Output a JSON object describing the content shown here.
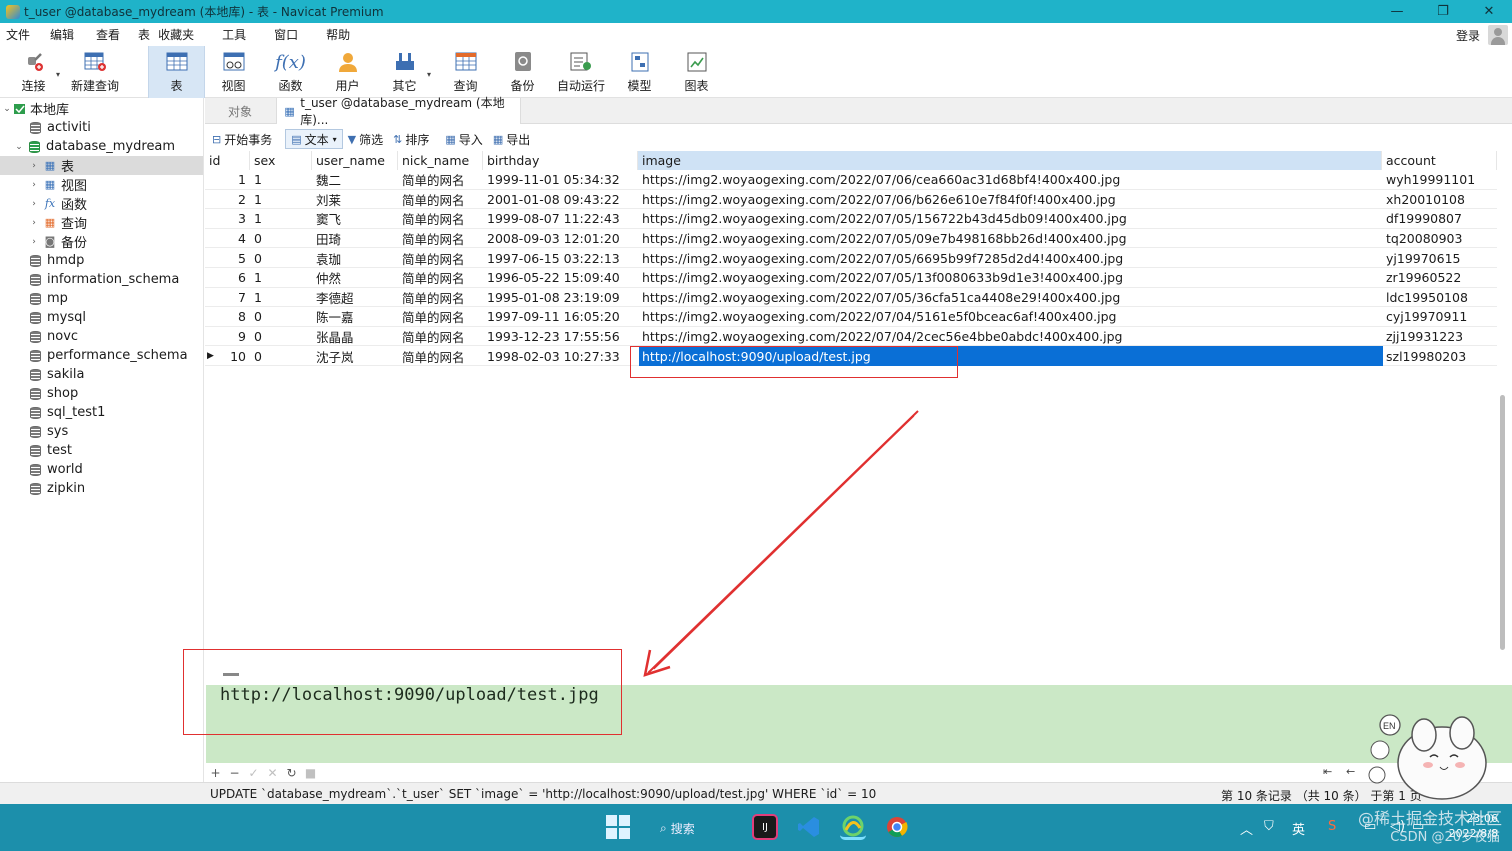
{
  "window": {
    "title": "t_user @database_mydream (本地库) - 表 - Navicat Premium",
    "controls": [
      "—",
      "❐",
      "✕"
    ]
  },
  "menu": {
    "items": [
      "文件",
      "编辑",
      "查看",
      "表",
      "收藏夹",
      "工具",
      "窗口",
      "帮助"
    ],
    "login": "登录"
  },
  "ribbon": {
    "buttons": [
      {
        "label": "连接",
        "icon": "plug-icon"
      },
      {
        "label": "新建查询",
        "icon": "new-query-icon"
      },
      {
        "label": "表",
        "icon": "table-icon"
      },
      {
        "label": "视图",
        "icon": "view-icon"
      },
      {
        "label": "函数",
        "icon": "function-icon"
      },
      {
        "label": "用户",
        "icon": "user-icon"
      },
      {
        "label": "其它",
        "icon": "tools-icon"
      },
      {
        "label": "查询",
        "icon": "query-icon"
      },
      {
        "label": "备份",
        "icon": "backup-icon"
      },
      {
        "label": "自动运行",
        "icon": "automation-icon"
      },
      {
        "label": "模型",
        "icon": "model-icon"
      },
      {
        "label": "图表",
        "icon": "chart-icon"
      }
    ]
  },
  "sidebar": {
    "connection": "本地库",
    "selected_db": "database_mydream",
    "db_children": [
      "表",
      "视图",
      "函数",
      "查询",
      "备份"
    ],
    "databases_before": [
      "activiti"
    ],
    "databases_after": [
      "hmdp",
      "information_schema",
      "mp",
      "mysql",
      "novc",
      "performance_schema",
      "sakila",
      "shop",
      "sql_test1",
      "sys",
      "test",
      "world",
      "zipkin"
    ]
  },
  "tabs": {
    "objects": "对象",
    "active": "t_user @database_mydream (本地库)..."
  },
  "table_toolbar": {
    "begin_tx": "开始事务",
    "text": "文本",
    "filter": "筛选",
    "sort": "排序",
    "import": "导入",
    "export": "导出"
  },
  "grid": {
    "columns": [
      "id",
      "sex",
      "user_name",
      "nick_name",
      "birthday",
      "image",
      "account"
    ],
    "rows": [
      [
        "1",
        "1",
        "魏二",
        "简单的网名",
        "1999-11-01 05:34:32",
        "https://img2.woyaogexing.com/2022/07/06/cea660ac31d68bf4!400x400.jpg",
        "wyh19991101"
      ],
      [
        "2",
        "1",
        "刘莱",
        "简单的网名",
        "2001-01-08 09:43:22",
        "https://img2.woyaogexing.com/2022/07/06/b626e610e7f84f0f!400x400.jpg",
        "xh20010108"
      ],
      [
        "3",
        "1",
        "窦飞",
        "简单的网名",
        "1999-08-07 11:22:43",
        "https://img2.woyaogexing.com/2022/07/05/156722b43d45db09!400x400.jpg",
        "df19990807"
      ],
      [
        "4",
        "0",
        "田琦",
        "简单的网名",
        "2008-09-03 12:01:20",
        "https://img2.woyaogexing.com/2022/07/05/09e7b498168bb26d!400x400.jpg",
        "tq20080903"
      ],
      [
        "5",
        "0",
        "袁珈",
        "简单的网名",
        "1997-06-15 03:22:13",
        "https://img2.woyaogexing.com/2022/07/05/6695b99f7285d2d4!400x400.jpg",
        "yj19970615"
      ],
      [
        "6",
        "1",
        "仲然",
        "简单的网名",
        "1996-05-22 15:09:40",
        "https://img2.woyaogexing.com/2022/07/05/13f0080633b9d1e3!400x400.jpg",
        "zr19960522"
      ],
      [
        "7",
        "1",
        "李德超",
        "简单的网名",
        "1995-01-08 23:19:09",
        "https://img2.woyaogexing.com/2022/07/05/36cfa51ca4408e29!400x400.jpg",
        "ldc19950108"
      ],
      [
        "8",
        "0",
        "陈一嘉",
        "简单的网名",
        "1997-09-11 16:05:20",
        "https://img2.woyaogexing.com/2022/07/04/5161e5f0bceac6af!400x400.jpg",
        "cyj19970911"
      ],
      [
        "9",
        "0",
        "张晶晶",
        "简单的网名",
        "1993-12-23 17:55:56",
        "https://img2.woyaogexing.com/2022/07/04/2cec56e4bbe0abdc!400x400.jpg",
        "zjj19931223"
      ],
      [
        "10",
        "0",
        "沈子岚",
        "简单的网名",
        "1998-02-03 10:27:33",
        "http://localhost:9090/upload/test.jpg",
        "szl19980203"
      ]
    ]
  },
  "text_panel": {
    "value": "http://localhost:9090/upload/test.jpg"
  },
  "status": {
    "sql": "UPDATE `database_mydream`.`t_user` SET `image` = 'http://localhost:9090/upload/test.jpg' WHERE `id` = 10",
    "count": "第 10 条记录 （共 10 条） 于第 1 页"
  },
  "taskbar": {
    "search": "搜索",
    "ime": "英",
    "time": "23:06",
    "date": "2022/8/8"
  },
  "watermark": {
    "line1": "@稀土掘金技术社区",
    "line2": "CSDN @20岁夜猫"
  },
  "colors": {
    "titlebar": "#1fb3c9",
    "taskbar": "#1c8fab",
    "selection": "#0a6fd6",
    "text_panel": "#cbe8c6",
    "annotation": "#e03030"
  }
}
